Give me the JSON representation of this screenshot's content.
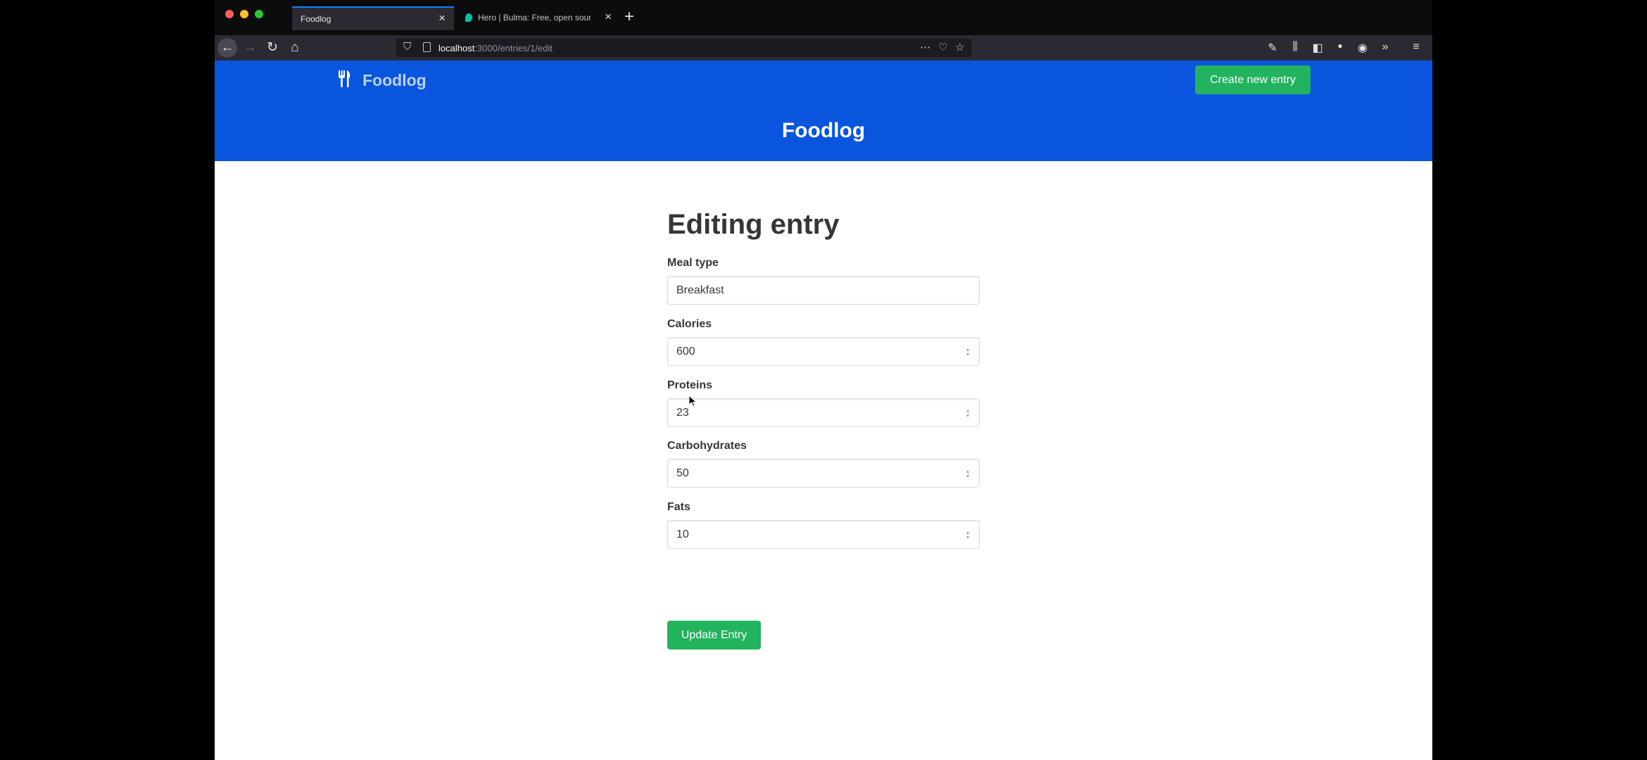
{
  "browser": {
    "tabs": [
      {
        "label": "Foodlog",
        "active": true
      },
      {
        "label": "Hero | Bulma: Free, open source",
        "active": false
      }
    ],
    "url": {
      "host": "localhost",
      "path": ":3000/entries/1/edit"
    }
  },
  "navbar": {
    "brand": "Foodlog",
    "create_button": "Create new entry"
  },
  "hero": {
    "title": "Foodlog"
  },
  "form": {
    "heading": "Editing entry",
    "fields": [
      {
        "label": "Meal type",
        "value": "Breakfast",
        "type": "text"
      },
      {
        "label": "Calories",
        "value": "600",
        "type": "number"
      },
      {
        "label": "Proteins",
        "value": "23",
        "type": "number"
      },
      {
        "label": "Carbohydrates",
        "value": "50",
        "type": "number"
      },
      {
        "label": "Fats",
        "value": "10",
        "type": "number"
      }
    ],
    "submit": "Update Entry"
  },
  "colors": {
    "hero": "#0a55dd",
    "primary_button": "#22b35e",
    "tab_accent": "#0a84ff"
  },
  "icons": [
    "back-icon",
    "forward-icon",
    "reload-icon",
    "home-icon",
    "shield-icon",
    "page-icon",
    "more-icon",
    "pocket-icon",
    "bookmark-star-icon",
    "wrench-icon",
    "library-icon",
    "sidebar-icon",
    "extension-icon",
    "account-icon",
    "overflow-icon",
    "menu-icon",
    "utensils-icon"
  ]
}
